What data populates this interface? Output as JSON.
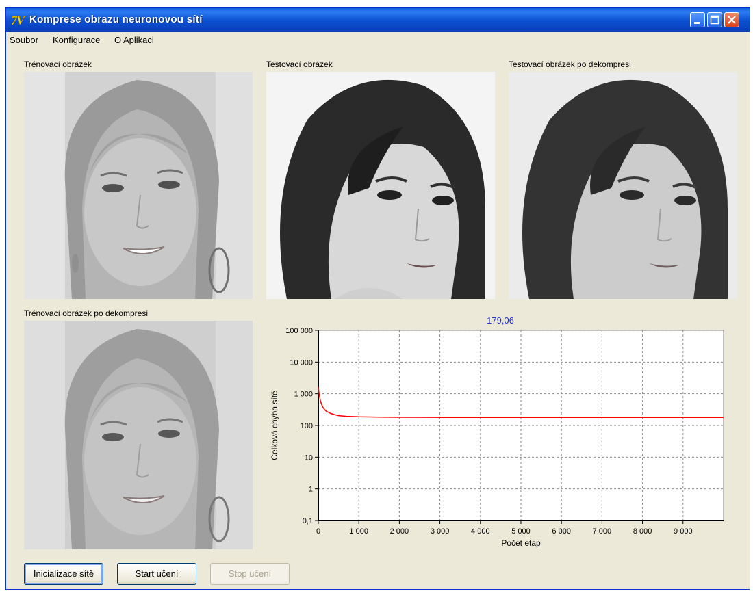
{
  "window": {
    "title": "Komprese obrazu neuronovou sítí"
  },
  "menu": {
    "items": [
      {
        "label": "Soubor"
      },
      {
        "label": "Konfigurace"
      },
      {
        "label": "O Aplikaci"
      }
    ]
  },
  "panels": {
    "training_image_label": "Trénovací obrázek",
    "test_image_label": "Testovací obrázek",
    "test_image_decompressed_label": "Testovací obrázek po dekompresi",
    "training_image_decompressed_label": "Trénovací obrázek po dekompresi"
  },
  "buttons": {
    "init": "Inicializace sítě",
    "start": "Start učení",
    "stop": "Stop učení"
  },
  "chart_data": {
    "type": "line",
    "title": "179,06",
    "xlabel": "Počet etap",
    "ylabel": "Celková chyba sítě",
    "y_scale": "log",
    "xlim": [
      0,
      10000
    ],
    "ylim": [
      0.1,
      100000
    ],
    "x_ticks": [
      0,
      1000,
      2000,
      3000,
      4000,
      5000,
      6000,
      7000,
      8000,
      9000
    ],
    "x_tick_labels": [
      "0",
      "1 000",
      "2 000",
      "3 000",
      "4 000",
      "5 000",
      "6 000",
      "7 000",
      "8 000",
      "9 000"
    ],
    "y_ticks": [
      0.1,
      1,
      10,
      100,
      1000,
      10000,
      100000
    ],
    "y_tick_labels": [
      "0,1",
      "1",
      "10",
      "100",
      "1 000",
      "10 000",
      "100 000"
    ],
    "grid": true,
    "series": [
      {
        "color": "#ff0000",
        "x": [
          0,
          20,
          50,
          100,
          150,
          200,
          300,
          400,
          500,
          700,
          1000,
          1500,
          2000,
          3000,
          4000,
          5000,
          6000,
          7000,
          8000,
          9000,
          10000
        ],
        "y": [
          1600,
          1000,
          600,
          400,
          320,
          280,
          240,
          220,
          205,
          195,
          188,
          184,
          182,
          180,
          180,
          179.5,
          179.3,
          179.2,
          179.1,
          179.06,
          179.06
        ]
      }
    ]
  }
}
